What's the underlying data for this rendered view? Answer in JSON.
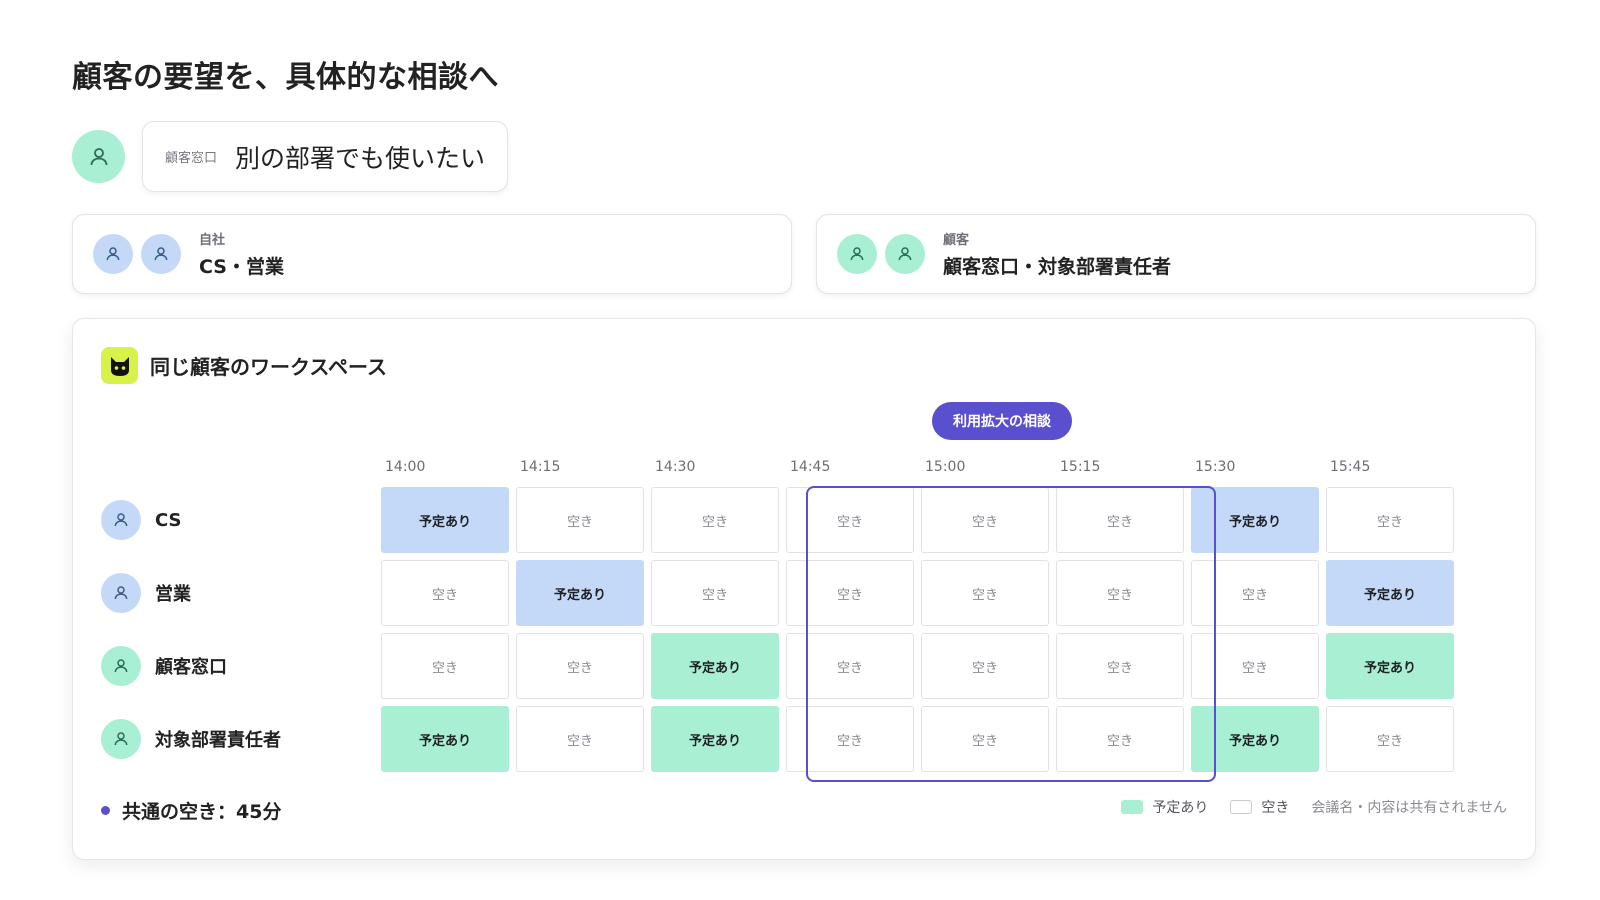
{
  "title": "顧客の要望を、具体的な相談へ",
  "request": {
    "who": "顧客窓口",
    "message": "別の部署でも使いたい"
  },
  "parties": {
    "own": {
      "label": "自社",
      "names": "CS・営業"
    },
    "customer": {
      "label": "顧客",
      "names": "顧客窓口・対象部署責任者"
    }
  },
  "workspace": {
    "title": "同じ顧客のワークスペース",
    "proposal_label": "利用拡大の相談",
    "times": [
      "14:00",
      "14:15",
      "14:30",
      "14:45",
      "15:00",
      "15:15",
      "15:30",
      "15:45"
    ],
    "rows": [
      {
        "name": "CS",
        "group": "own",
        "cells": [
          "予定あり",
          "空き",
          "空き",
          "空き",
          "空き",
          "空き",
          "予定あり",
          "空き"
        ]
      },
      {
        "name": "営業",
        "group": "own",
        "cells": [
          "空き",
          "予定あり",
          "空き",
          "空き",
          "空き",
          "空き",
          "空き",
          "予定あり"
        ]
      },
      {
        "name": "顧客窓口",
        "group": "customer",
        "cells": [
          "空き",
          "空き",
          "予定あり",
          "空き",
          "空き",
          "空き",
          "空き",
          "予定あり"
        ]
      },
      {
        "name": "対象部署責任者",
        "group": "customer",
        "cells": [
          "予定あり",
          "空き",
          "予定あり",
          "空き",
          "空き",
          "空き",
          "予定あり",
          "空き"
        ]
      }
    ],
    "common_free": "共通の空き：45分",
    "legend": {
      "busy": "予定あり",
      "free": "空き",
      "note": "会議名・内容は共有されません"
    }
  },
  "colors": {
    "accent": "#5a4fcf",
    "own_busy": "#c3d9f7",
    "customer_busy": "#a8efd3",
    "logo_bg": "#d9f24a"
  }
}
